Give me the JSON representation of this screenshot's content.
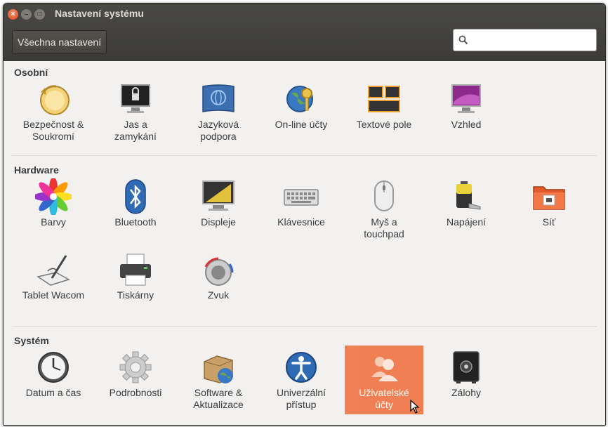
{
  "window": {
    "title": "Nastavení systému"
  },
  "toolbar": {
    "all_settings_label": "Všechna nastavení",
    "search_placeholder": ""
  },
  "sections": [
    {
      "title": "Osobní",
      "items": [
        {
          "label": "Bezpečnost &\nSoukromí",
          "icon": "privacy-icon"
        },
        {
          "label": "Jas a\nzamykání",
          "icon": "lock-icon"
        },
        {
          "label": "Jazyková\npodpora",
          "icon": "language-icon"
        },
        {
          "label": "On-line účty",
          "icon": "online-accounts-icon"
        },
        {
          "label": "Textové pole",
          "icon": "text-entry-icon"
        },
        {
          "label": "Vzhled",
          "icon": "appearance-icon"
        }
      ]
    },
    {
      "title": "Hardware",
      "items": [
        {
          "label": "Barvy",
          "icon": "color-icon"
        },
        {
          "label": "Bluetooth",
          "icon": "bluetooth-icon"
        },
        {
          "label": "Displeje",
          "icon": "display-icon"
        },
        {
          "label": "Klávesnice",
          "icon": "keyboard-icon"
        },
        {
          "label": "Myš a\ntouchpad",
          "icon": "mouse-icon"
        },
        {
          "label": "Napájení",
          "icon": "power-icon"
        },
        {
          "label": "Síť",
          "icon": "network-icon"
        },
        {
          "label": "Tablet Wacom",
          "icon": "tablet-icon"
        },
        {
          "label": "Tiskárny",
          "icon": "printer-icon"
        },
        {
          "label": "Zvuk",
          "icon": "sound-icon"
        }
      ]
    },
    {
      "title": "Systém",
      "items": [
        {
          "label": "Datum a čas",
          "icon": "clock-icon"
        },
        {
          "label": "Podrobnosti",
          "icon": "gear-icon"
        },
        {
          "label": "Software &\nAktualizace",
          "icon": "software-icon"
        },
        {
          "label": "Univerzální\npřístup",
          "icon": "accessibility-icon"
        },
        {
          "label": "Uživatelské\núčty",
          "icon": "user-accounts-icon",
          "selected": true
        },
        {
          "label": "Zálohy",
          "icon": "backup-icon"
        }
      ]
    }
  ],
  "colors": {
    "titlebar": "#3c3b37",
    "selected": "#f07746",
    "accent": "#df4a16"
  }
}
